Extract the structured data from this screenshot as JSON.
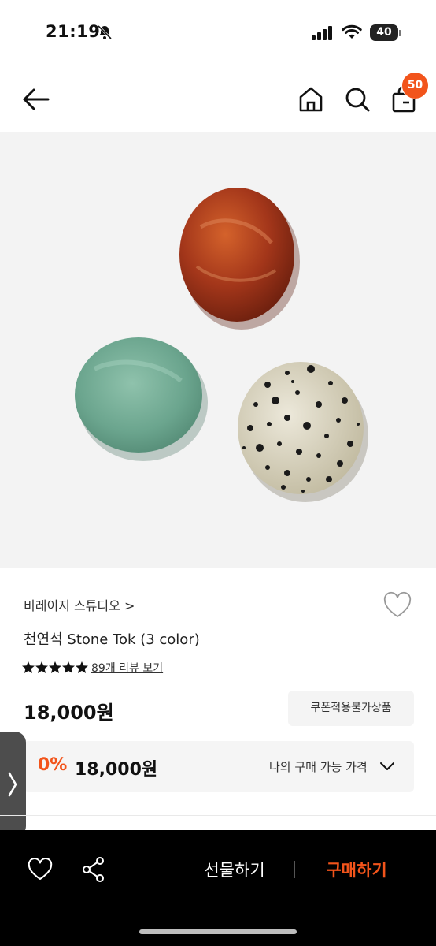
{
  "status": {
    "time": "21:19",
    "battery": "40"
  },
  "header": {
    "cart_count": "50"
  },
  "colors": {
    "accent": "#f2541b"
  },
  "icons": [
    "arrow-left-icon",
    "home-icon",
    "search-icon",
    "cart-icon",
    "bell-off-icon",
    "heart-icon",
    "share-icon",
    "chevron-down-icon",
    "chevron-right-icon"
  ],
  "product": {
    "brand": "비레이지 스튜디오",
    "brand_arrow": ">",
    "title": "천연석 Stone Tok (3 color)",
    "rating": 5,
    "review_text": "89개 리뷰 보기",
    "price": "18,000원",
    "coupon_badge": "쿠폰적용불가상품",
    "my_price": {
      "discount": "0%",
      "amount": "18,000원",
      "label": "나의 구매 가능 가격"
    }
  },
  "bottom_bar": {
    "gift_label": "선물하기",
    "buy_label": "구매하기"
  }
}
